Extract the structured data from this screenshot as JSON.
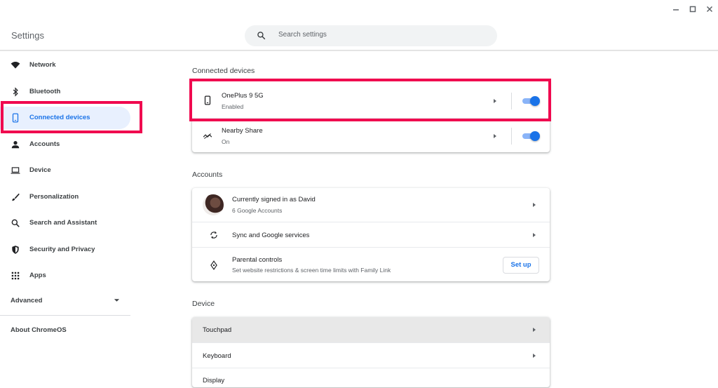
{
  "window": {
    "title": "Settings",
    "controls": {
      "minimize": "minimize-icon",
      "maximize": "maximize-icon",
      "close": "close-icon"
    }
  },
  "search": {
    "placeholder": "Search settings",
    "icon": "search-icon"
  },
  "sidebar": {
    "items": [
      {
        "label": "Network",
        "icon": "wifi-icon",
        "selected": false
      },
      {
        "label": "Bluetooth",
        "icon": "bluetooth-icon",
        "selected": false
      },
      {
        "label": "Connected devices",
        "icon": "phone-icon",
        "selected": true
      },
      {
        "label": "Accounts",
        "icon": "person-icon",
        "selected": false
      },
      {
        "label": "Device",
        "icon": "laptop-icon",
        "selected": false
      },
      {
        "label": "Personalization",
        "icon": "brush-icon",
        "selected": false
      },
      {
        "label": "Search and Assistant",
        "icon": "search-icon",
        "selected": false
      },
      {
        "label": "Security and Privacy",
        "icon": "shield-icon",
        "selected": false
      },
      {
        "label": "Apps",
        "icon": "apps-grid-icon",
        "selected": false
      }
    ],
    "advanced": {
      "label": "Advanced",
      "icon": "caret-down-icon"
    },
    "about": {
      "label": "About ChromeOS"
    }
  },
  "main": {
    "connected_devices": {
      "title": "Connected devices",
      "rows": [
        {
          "name": "OnePlus 9 5G",
          "status": "Enabled",
          "icon": "phone-icon",
          "enabled": true
        },
        {
          "name": "Nearby Share",
          "status": "On",
          "icon": "nearby-share-icon",
          "enabled": true
        }
      ]
    },
    "accounts": {
      "title": "Accounts",
      "signed_in": {
        "title": "Currently signed in as David",
        "subtitle": "6 Google Accounts"
      },
      "sync": {
        "title": "Sync and Google services",
        "icon": "sync-icon"
      },
      "parental": {
        "title": "Parental controls",
        "subtitle": "Set website restrictions & screen time limits with Family Link",
        "button": "Set up",
        "icon": "parental-controls-icon"
      }
    },
    "device": {
      "title": "Device",
      "rows": [
        {
          "label": "Touchpad"
        },
        {
          "label": "Keyboard"
        },
        {
          "label": "Display"
        }
      ]
    }
  },
  "colors": {
    "accent": "#1a73e8",
    "highlight": "#f0094f",
    "selected_bg": "#e8f0fe"
  }
}
